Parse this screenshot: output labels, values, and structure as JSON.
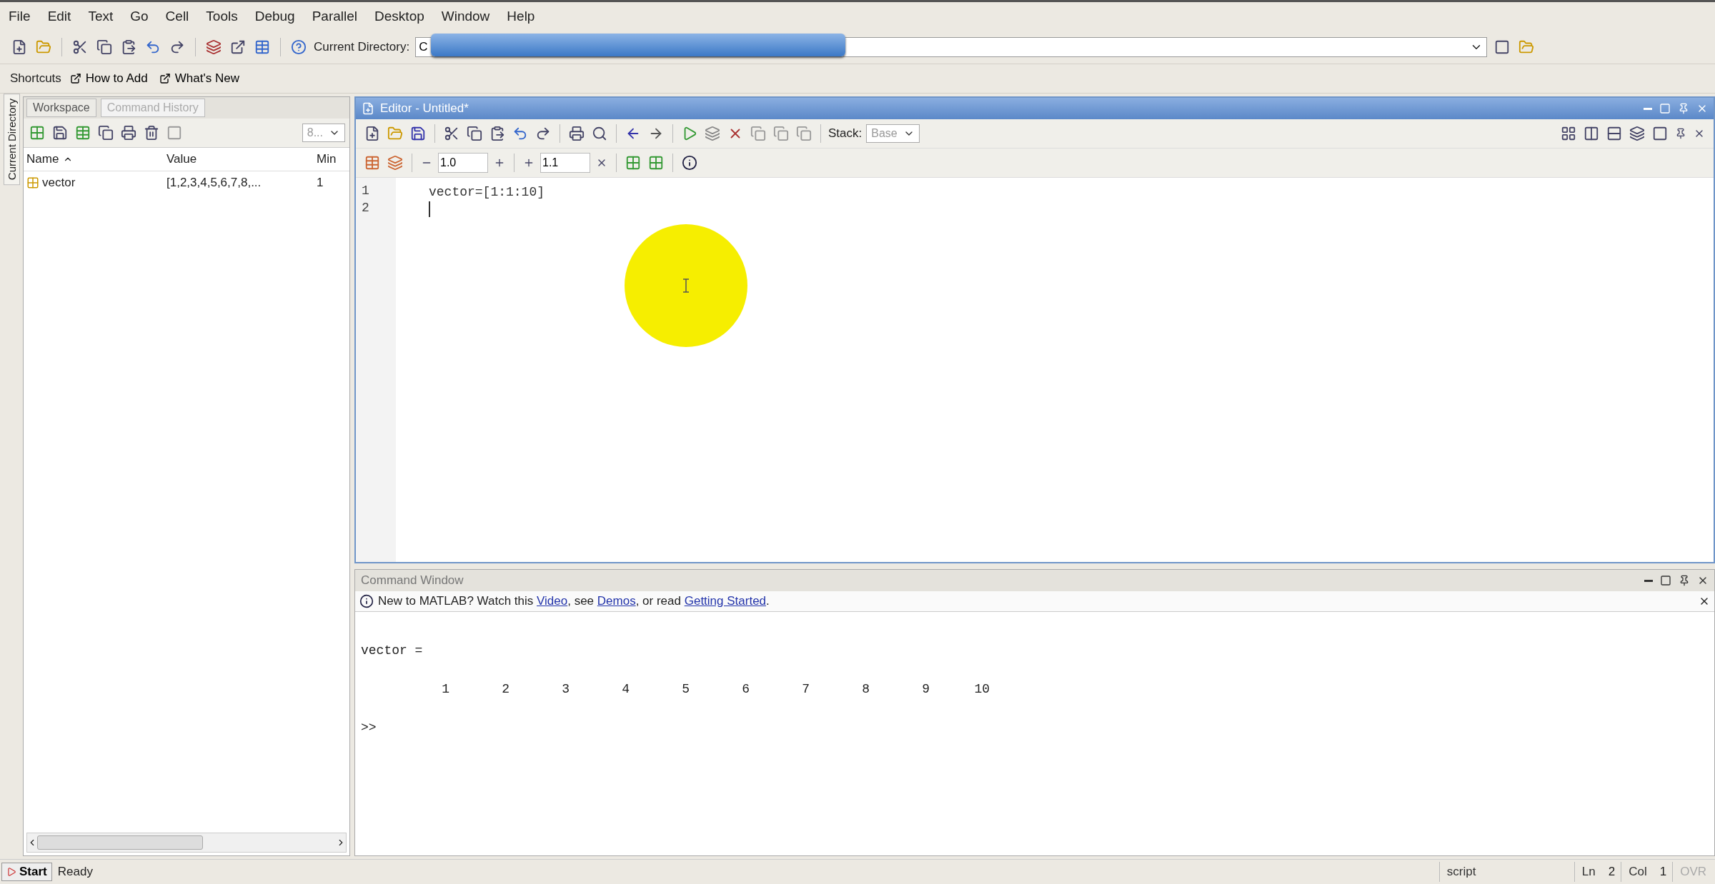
{
  "menu": [
    "File",
    "Edit",
    "Text",
    "Go",
    "Cell",
    "Tools",
    "Debug",
    "Parallel",
    "Desktop",
    "Window",
    "Help"
  ],
  "toolbar": {
    "current_directory_label": "Current Directory:",
    "current_directory": "C"
  },
  "shortcuts": [
    "Shortcuts",
    "How to Add",
    "What's New"
  ],
  "side_tab": "Current Directory",
  "workspace": {
    "tabs": [
      {
        "label": "Workspace",
        "selected": true
      },
      {
        "label": "Command History",
        "selected": false
      }
    ],
    "dropdown": "8...",
    "columns": [
      {
        "label": "Name",
        "sorted": true
      },
      {
        "label": "Value",
        "sorted": false
      },
      {
        "label": "Min",
        "sorted": false
      }
    ],
    "rows": [
      {
        "name": "vector",
        "value": "[1,2,3,4,5,6,7,8,...",
        "min": "1"
      }
    ]
  },
  "editor": {
    "title": "Editor - Untitled*",
    "cell_fields": [
      "1.0",
      "1.1"
    ],
    "stack_label": "Stack:",
    "stack": "Base",
    "lines": [
      {
        "number": "1",
        "code": "vector=[1:1:10]",
        "cursor": false
      },
      {
        "number": "2",
        "cursor": true
      }
    ]
  },
  "command_window": {
    "title": "Command Window",
    "notice": [
      {
        "kind": "text",
        "text": "New to MATLAB? Watch this "
      },
      {
        "kind": "link",
        "text": "Video"
      },
      {
        "kind": "text",
        "text": ", see "
      },
      {
        "kind": "link",
        "text": "Demos"
      },
      {
        "kind": "text",
        "text": ", or read "
      },
      {
        "kind": "link",
        "text": "Getting Started"
      },
      {
        "kind": "text",
        "text": "."
      }
    ],
    "output": {
      "variable_line": "vector =",
      "values": [
        "1",
        "2",
        "3",
        "4",
        "5",
        "6",
        "7",
        "8",
        "9",
        "10"
      ],
      "prompt": ">>"
    }
  },
  "status_bar": {
    "start": "Start",
    "status": "Ready",
    "mode": "script",
    "ln_label": "Ln",
    "ln": "2",
    "col_label": "Col",
    "col": "1",
    "ovr": "OVR"
  }
}
